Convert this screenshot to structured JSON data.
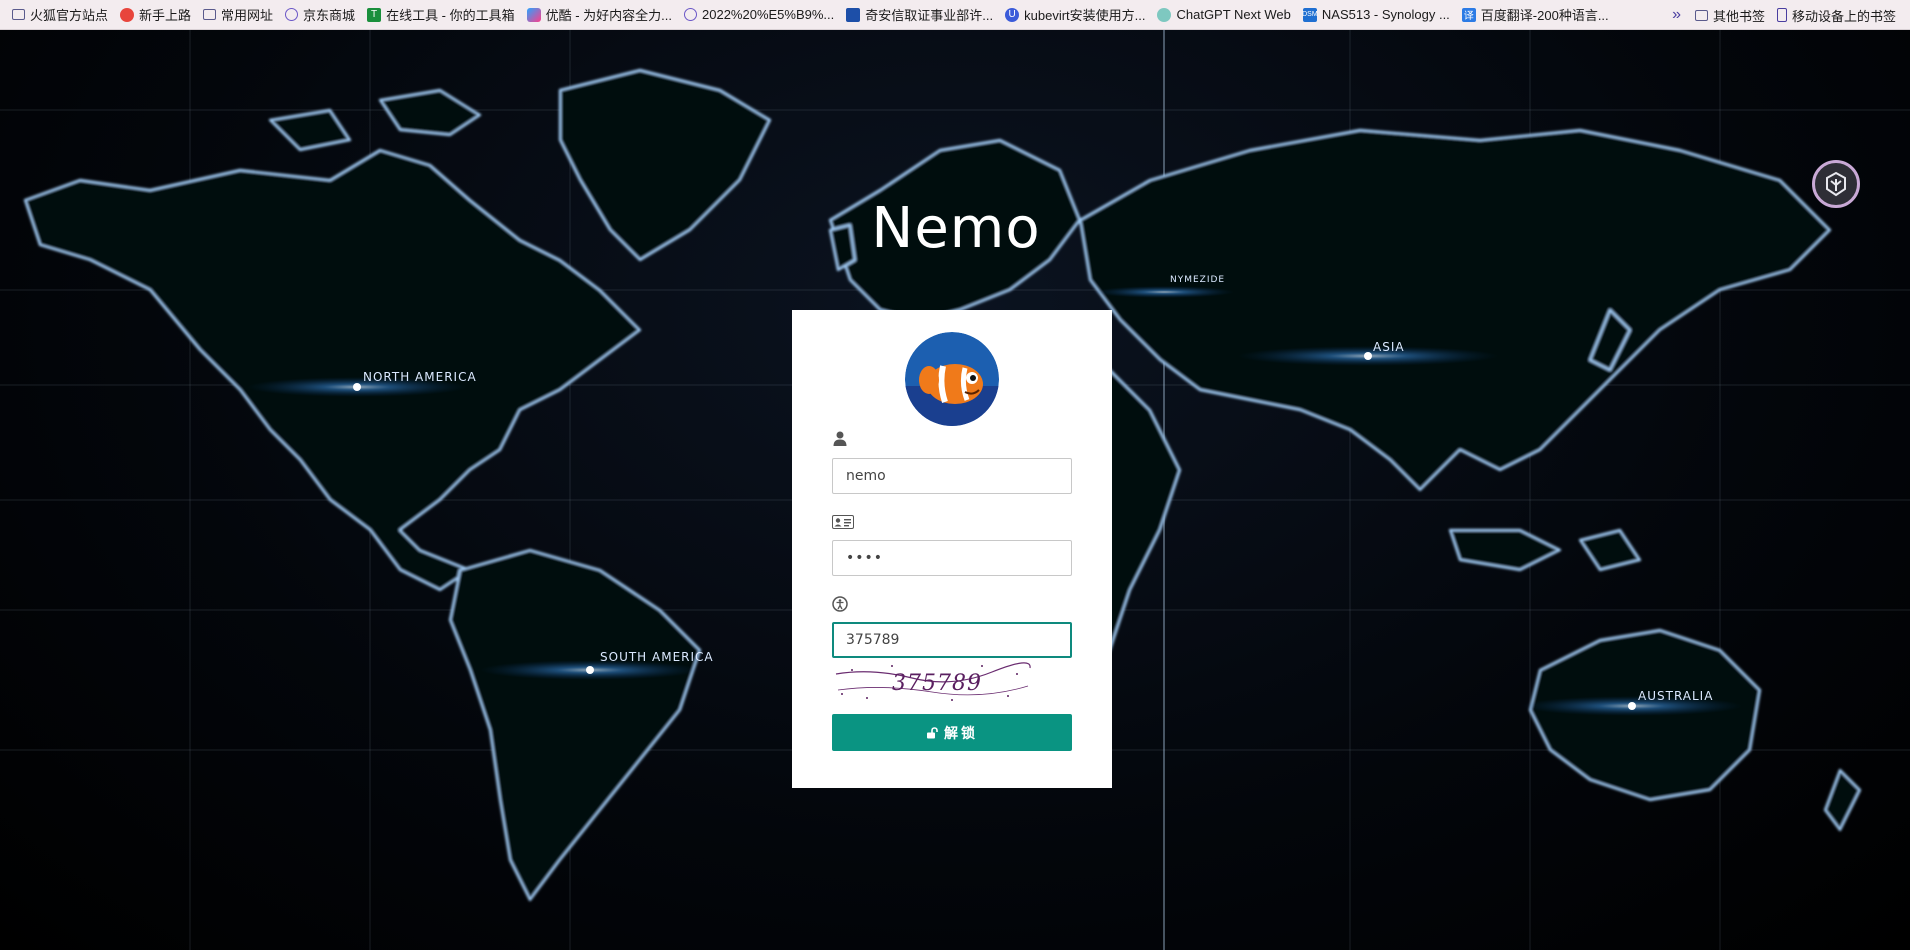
{
  "bookmarks": {
    "items": [
      {
        "label": "火狐官方站点",
        "icon": "folder-icon"
      },
      {
        "label": "新手上路",
        "icon": "firefox-icon"
      },
      {
        "label": "常用网址",
        "icon": "folder-icon"
      },
      {
        "label": "京东商城",
        "icon": "globe-icon"
      },
      {
        "label": "在线工具 - 你的工具箱",
        "icon": "tools-icon"
      },
      {
        "label": "优酷 - 为好内容全力...",
        "icon": "youku-icon"
      },
      {
        "label": "2022%20%E5%B9%...",
        "icon": "globe-icon"
      },
      {
        "label": "奇安信取证事业部许...",
        "icon": "qianxin-icon"
      },
      {
        "label": "kubevirt安装使用方...",
        "icon": "u-icon"
      },
      {
        "label": "ChatGPT Next Web",
        "icon": "chatgpt-icon"
      },
      {
        "label": "NAS513 - Synology ...",
        "icon": "dsm-icon"
      },
      {
        "label": "百度翻译-200种语言...",
        "icon": "baidu-translate-icon"
      }
    ],
    "other_label": "其他书签",
    "mobile_label": "移动设备上的书签"
  },
  "site": {
    "title": "Nemo"
  },
  "map_labels": {
    "north_america": "NORTH AMERICA",
    "south_america": "SOUTH AMERICA",
    "asia": "ASIA",
    "australia": "AUSTRALIA",
    "nymezide": "NYMEZIDE"
  },
  "login": {
    "username_value": "nemo",
    "password_value": "••••",
    "captcha_value": "375789",
    "captcha_image_text": "375789",
    "unlock_label": "解锁"
  },
  "colors": {
    "accent": "#0a9482",
    "card_bg": "#ffffff",
    "bookmark_bar": "#f3ecef"
  }
}
